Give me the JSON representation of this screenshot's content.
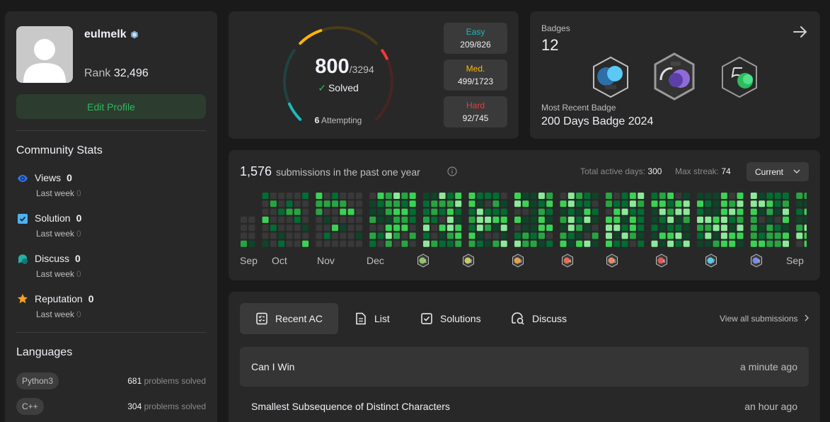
{
  "profile": {
    "username": "eulmelk",
    "rank_label": "Rank",
    "rank_value": "32,496",
    "edit_label": "Edit Profile"
  },
  "community": {
    "title": "Community Stats",
    "stats": [
      {
        "label": "Views",
        "value": "0",
        "sub_label": "Last week",
        "sub_value": "0",
        "icon": "eye-icon"
      },
      {
        "label": "Solution",
        "value": "0",
        "sub_label": "Last week",
        "sub_value": "0",
        "icon": "solution-icon"
      },
      {
        "label": "Discuss",
        "value": "0",
        "sub_label": "Last week",
        "sub_value": "0",
        "icon": "discuss-icon"
      },
      {
        "label": "Reputation",
        "value": "0",
        "sub_label": "Last week",
        "sub_value": "0",
        "icon": "star-icon"
      }
    ]
  },
  "languages": {
    "title": "Languages",
    "items": [
      {
        "name": "Python3",
        "count": "681",
        "suffix": "problems solved"
      },
      {
        "name": "C++",
        "count": "304",
        "suffix": "problems solved"
      }
    ]
  },
  "solved": {
    "count": "800",
    "total": "/3294",
    "label": "Solved",
    "attempting_count": "6",
    "attempting_label": "Attempting",
    "easy_fraction": 0.253,
    "medium_fraction": 0.29,
    "hard_fraction": 0.123,
    "difficulties": [
      {
        "label": "Easy",
        "value": "209/826",
        "color": "#1cbaba"
      },
      {
        "label": "Med.",
        "value": "499/1723",
        "color": "#ffb700"
      },
      {
        "label": "Hard",
        "value": "92/745",
        "color": "#f63737"
      }
    ]
  },
  "badges": {
    "title": "Badges",
    "count": "12",
    "recent_label": "Most Recent Badge",
    "recent_name": "200 Days Badge 2024"
  },
  "submissions": {
    "count": "1,576",
    "label": "submissions in the past one year",
    "active_label": "Total active days:",
    "active_value": "300",
    "streak_label": "Max streak:",
    "streak_value": "74",
    "selector": "Current",
    "months": [
      "Sep",
      "Oct",
      "Nov",
      "Dec",
      "Sep"
    ],
    "mini_badge_labels": [
      "1",
      "2",
      "3",
      "4",
      "5",
      "6",
      "7",
      "8"
    ]
  },
  "recent": {
    "tabs": [
      {
        "label": "Recent AC",
        "icon": "checklist-icon"
      },
      {
        "label": "List",
        "icon": "list-icon"
      },
      {
        "label": "Solutions",
        "icon": "solutions-icon"
      },
      {
        "label": "Discuss",
        "icon": "discuss-search-icon"
      }
    ],
    "view_all": "View all submissions",
    "rows": [
      {
        "title": "Can I Win",
        "time": "a minute ago"
      },
      {
        "title": "Smallest Subsequence of Distinct Characters",
        "time": "an hour ago"
      }
    ]
  }
}
